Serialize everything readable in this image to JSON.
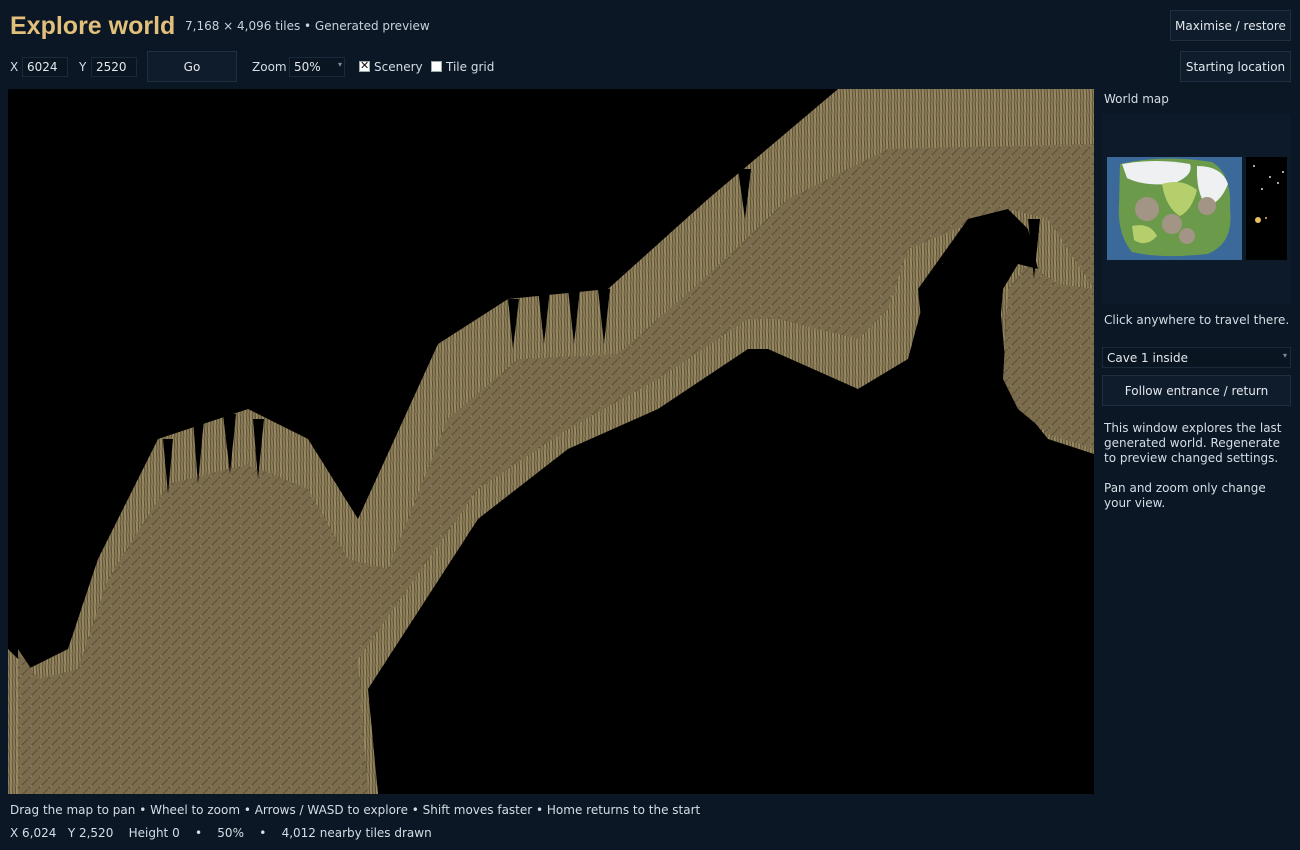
{
  "header": {
    "title": "Explore world",
    "subtitle": "7,168 × 4,096 tiles  •  Generated preview",
    "maximise_label": "Maximise / restore"
  },
  "toolbar": {
    "x_label": "X",
    "x_value": "6024",
    "y_label": "Y",
    "y_value": "2520",
    "go_label": "Go",
    "zoom_label": "Zoom",
    "zoom_value": "50%",
    "scenery_label": "Scenery",
    "scenery_checked": true,
    "grid_label": "Tile grid",
    "grid_checked": false,
    "starting_label": "Starting location"
  },
  "sidebar": {
    "world_map_label": "World map",
    "click_hint": "Click anywhere to travel there.",
    "location_value": "Cave 1 inside",
    "follow_label": "Follow entrance / return",
    "note1": "This window explores the last generated world. Regenerate to preview changed settings.",
    "note2": "Pan and zoom only change your view."
  },
  "footer": {
    "help": "Drag the map to pan • Wheel to zoom • Arrows / WASD to explore • Shift moves faster • Home returns to the start",
    "status": "X 6,024   Y 2,520    Height 0    •    50%    •    4,012 nearby tiles drawn"
  },
  "colors": {
    "accent": "#e2bf7a",
    "background": "#0b1724",
    "cave_floor": "#7a6c4c",
    "cave_wall": "#9a8a62"
  }
}
